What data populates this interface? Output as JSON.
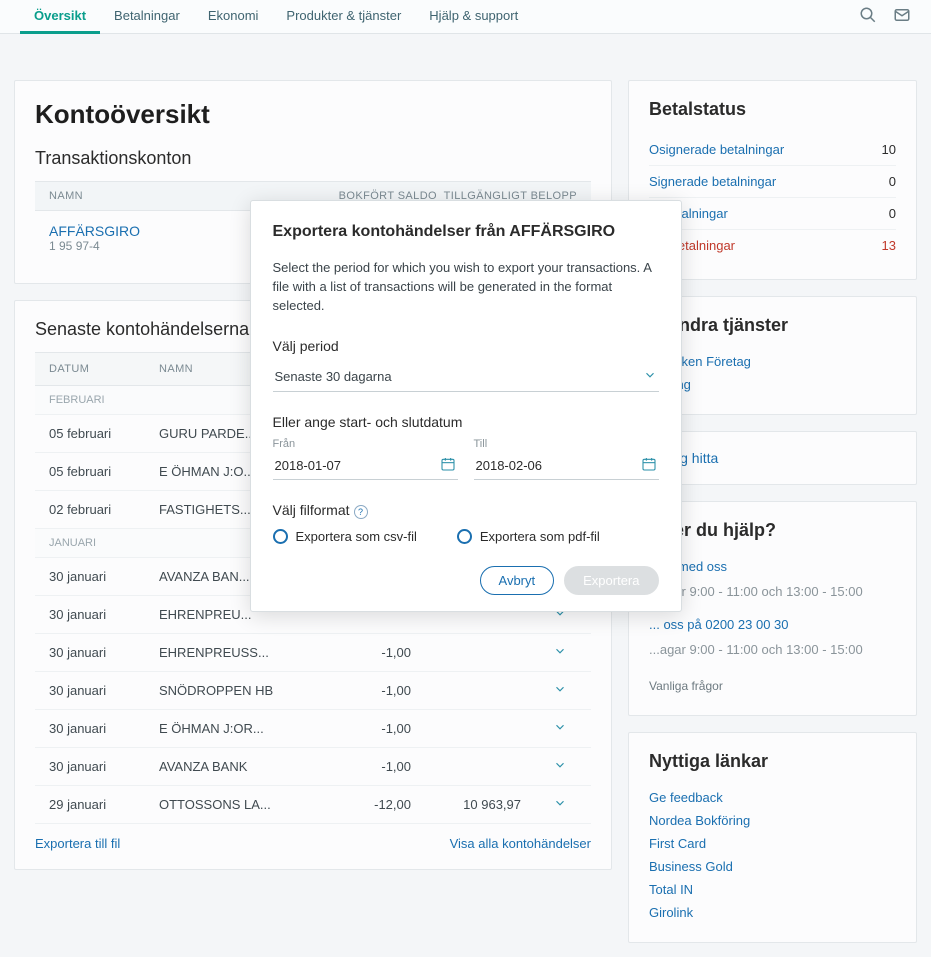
{
  "nav": {
    "tabs": [
      "Översikt",
      "Betalningar",
      "Ekonomi",
      "Produkter & tjänster",
      "Hjälp & support"
    ],
    "active": 0
  },
  "overview": {
    "title": "Kontoöversikt",
    "section": "Transaktionskonton",
    "headers": {
      "name": "NAMN",
      "booked": "BOKFÖRT SALDO",
      "avail": "TILLGÄNGLIGT BELOPP"
    },
    "account": {
      "name": "AFFÄRSGIRO",
      "number": "1 95 97-4"
    }
  },
  "latest": {
    "title": "Senaste kontohändelserna",
    "headers": {
      "date": "DATUM",
      "name": "NAMN"
    },
    "groups": [
      {
        "label": "FEBRUARI",
        "rows": [
          {
            "date": "05 februari",
            "name": "GURU PARDE..."
          },
          {
            "date": "05 februari",
            "name": "E ÖHMAN J:O..."
          },
          {
            "date": "02 februari",
            "name": "FASTIGHETS..."
          }
        ]
      },
      {
        "label": "JANUARI",
        "rows": [
          {
            "date": "30 januari",
            "name": "AVANZA BAN..."
          },
          {
            "date": "30 januari",
            "name": "EHRENPREU..."
          },
          {
            "date": "30 januari",
            "name": "EHRENPREUSS...",
            "amount": "-1,00"
          },
          {
            "date": "30 januari",
            "name": "SNÖDROPPEN HB",
            "amount": "-1,00"
          },
          {
            "date": "30 januari",
            "name": "E ÖHMAN J:OR...",
            "amount": "-1,00"
          },
          {
            "date": "30 januari",
            "name": "AVANZA BANK",
            "amount": "-1,00"
          },
          {
            "date": "29 januari",
            "name": "OTTOSSONS LA...",
            "amount": "-12,00",
            "balance": "10 963,97"
          }
        ]
      }
    ],
    "export": "Exportera till fil",
    "viewall": "Visa alla kontohändelser"
  },
  "status": {
    "title": "Betalstatus",
    "rows": [
      {
        "label": "Osignerade betalningar",
        "value": "10",
        "cls": ""
      },
      {
        "label": "Signerade betalningar",
        "value": "0",
        "cls": ""
      },
      {
        "label": "... betalningar",
        "value": "0",
        "cls": ""
      },
      {
        "label": "...e betalningar",
        "value": "13",
        "cls": "red"
      }
    ]
  },
  "other": {
    "title": "... andra tjänster",
    "items": [
      "...banken Företag",
      "...sning"
    ]
  },
  "find": {
    "label": "...r dig hitta"
  },
  "help": {
    "title": "...ver du hjälp?",
    "chat": "...tta med oss",
    "hours": "...agar 9:00 - 11:00 och 13:00 - 15:00",
    "call": "... oss på 0200 23 00 30",
    "faq": "Vanliga frågor"
  },
  "useful": {
    "title": "Nyttiga länkar",
    "links": [
      "Ge feedback",
      "Nordea Bokföring",
      "First Card",
      "Business Gold",
      "Total IN",
      "Girolink"
    ]
  },
  "modal": {
    "title": "Exportera kontohändelser från AFFÄRSGIRO",
    "desc": "Select the period for which you wish to export your transactions. A file with a list of transactions will be generated in the format selected.",
    "period_lbl": "Välj period",
    "period_val": "Senaste 30 dagarna",
    "range_lbl": "Eller ange start- och slutdatum",
    "from_lbl": "Från",
    "from_val": "2018-01-07",
    "to_lbl": "Till",
    "to_val": "2018-02-06",
    "format_lbl": "Välj filformat",
    "opt_csv": "Exportera som csv-fil",
    "opt_pdf": "Exportera som pdf-fil",
    "cancel": "Avbryt",
    "submit": "Exportera"
  }
}
